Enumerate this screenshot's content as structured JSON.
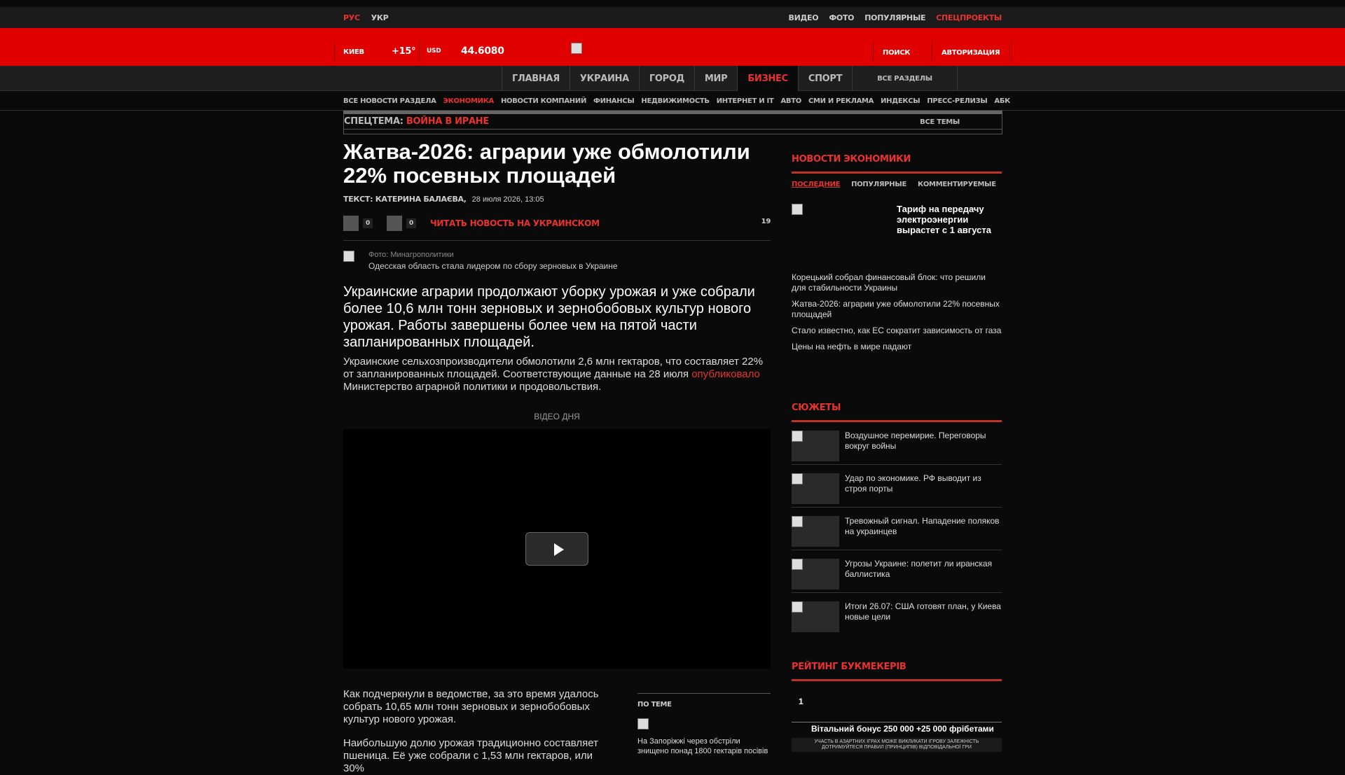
{
  "topbar": {
    "lang_ru": "РУС",
    "lang_ua": "УКР",
    "video": "ВИДЕО",
    "photo": "ФОТО",
    "popular": "ПОПУЛЯРНЫЕ",
    "special": "СПЕЦПРОЕКТЫ"
  },
  "header": {
    "city": "КИЕВ",
    "temp": "+15°",
    "cur": "USD",
    "rate": "44.6080",
    "search": "ПОИСК",
    "auth": "АВТОРИЗАЦИЯ"
  },
  "nav": {
    "items": [
      "ГЛАВНАЯ",
      "УКРАИНА",
      "ГОРОД",
      "МИР",
      "БИЗНЕС",
      "СПОРТ"
    ],
    "all": "ВСЕ РАЗДЕЛЫ"
  },
  "subnav": [
    "ВСЕ НОВОСТИ РАЗДЕЛА",
    "ЭКОНОМИКА",
    "НОВОСТИ КОМПАНИЙ",
    "ФИНАНСЫ",
    "НЕДВИЖИМОСТЬ",
    "ИНТЕРНЕТ И IT",
    "АВТО",
    "СМИ И РЕКЛАМА",
    "ИНДЕКСЫ",
    "ПРЕСС-РЕЛИЗЫ",
    "АБК"
  ],
  "spectema": {
    "label": "СПЕЦТЕМА:",
    "topic": "ВОЙНА В ИРАНЕ",
    "all": "ВСЕ ТЕМЫ"
  },
  "article": {
    "title": "Жатва-2026: аграрии уже обмолотили 22% посевных площадей",
    "author": "ТЕКСТ: КАТЕРИНА БАЛАЄВА,",
    "date": "28 июля 2026, 13:05",
    "like": "0",
    "dislike": "0",
    "read_ua": "ЧИТАТЬ НОВОСТЬ НА УКРАИНСКОМ",
    "comments": "19",
    "photo_credit": "Фото: Минагрополитики",
    "photo_caption": "Одесская область стала лидером по сбору зерновых в Украине",
    "lead": "Украинские аграрии продолжают уборку урожая и уже собрали более 10,6 млн тонн зерновых и зернобобовых культур нового урожая. Работы завершены более чем на пятой части запланированных площадей.",
    "p1_a": "Украинские сельхозпроизводители обмолотили 2,6 млн гектаров, что составляет 22% от запланированных площадей. Соответствующие данные на 28 июля ",
    "p1_link": "опубликовало",
    "p1_b": " Министерство аграрной политики и продовольствия.",
    "video_label": "ВІДЕО ДНЯ",
    "p2": "Как подчеркнули в ведомстве, за это время удалось собрать 10,65 млн тонн зерновых и зернобобовых культур нового урожая.",
    "p3": "Наибольшую долю урожая традиционно составляет пшеница. Её уже собрали с 1,53 млн гектаров, или 30%",
    "by_theme": "ПО ТЕМЕ",
    "by_theme_text": "На Запоріжжі через обстріли знищено понад 1800 гектарів посівів"
  },
  "sidebar": {
    "title": "НОВОСТИ ЭКОНОМИКИ",
    "tabs": [
      "ПОСЛЕДНИЕ",
      "ПОПУЛЯРНЫЕ",
      "КОММЕНТИРУЕМЫЕ"
    ],
    "top_news": "Тариф на передачу электроэнергии вырастет с 1 августа",
    "news": [
      "Корецький собрал финансовый блок: что решили для стабильности Украины",
      "Жатва-2026: аграрии уже обмолотили 22% посевных площадей",
      "Стало известно, как ЕС сократит зависимость от газа",
      "Цены на нефть в мире падают"
    ],
    "stories_title": "СЮЖЕТЫ",
    "stories": [
      "Воздушное перемирие. Переговоры вокруг войны",
      "Удар по экономике. РФ выводит из строя порты",
      "Тревожный сигнал. Нападение поляков на украинцев",
      "Угрозы Украине: полетит ли иранская баллистика",
      "Итоги 26.07: США готовят план, у Киева новые цели"
    ],
    "book_title": "РЕЙТИНГ БУКМЕКЕРІВ",
    "book_num": "1",
    "book_bonus": "Вітальний бонус 250 000 +25 000 фрібетами",
    "book_warn": "УЧАСТЬ В АЗАРТНИХ ІГРАХ МОЖЕ ВИКЛИКАТИ ІГРОВУ ЗАЛЕЖНІСТЬ ДОТРИМУЙТЕСЯ ПРАВИЛ (ПРИНЦИПІВ) ВІДПОВІДАЛЬНОЇ ГРИ"
  }
}
